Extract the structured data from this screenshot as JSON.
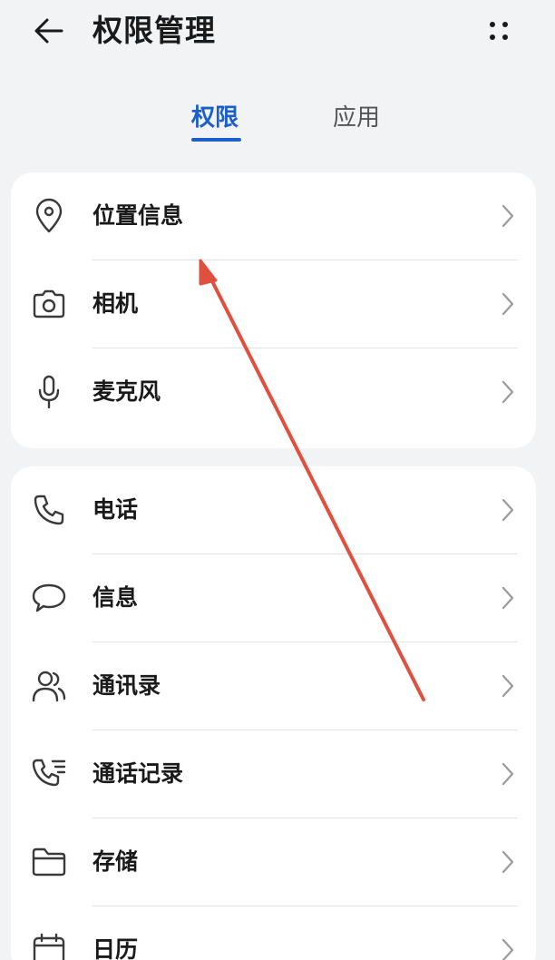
{
  "header": {
    "title": "权限管理",
    "back_icon": "arrow-left-icon",
    "more_icon": "more-dots-icon"
  },
  "tabs": [
    {
      "label": "权限",
      "active": true
    },
    {
      "label": "应用",
      "active": false
    }
  ],
  "groups": [
    {
      "items": [
        {
          "label": "位置信息",
          "icon": "location-pin-icon"
        },
        {
          "label": "相机",
          "icon": "camera-icon"
        },
        {
          "label": "麦克风",
          "icon": "microphone-icon"
        }
      ]
    },
    {
      "items": [
        {
          "label": "电话",
          "icon": "phone-icon"
        },
        {
          "label": "信息",
          "icon": "message-icon"
        },
        {
          "label": "通讯录",
          "icon": "contacts-icon"
        },
        {
          "label": "通话记录",
          "icon": "call-log-icon"
        },
        {
          "label": "存储",
          "icon": "folder-icon"
        },
        {
          "label": "日历",
          "icon": "calendar-icon"
        }
      ]
    }
  ],
  "colors": {
    "accent": "#1d5fc9",
    "background": "#f1f3f5",
    "card": "#ffffff",
    "annotation_arrow": "#e0503e"
  }
}
